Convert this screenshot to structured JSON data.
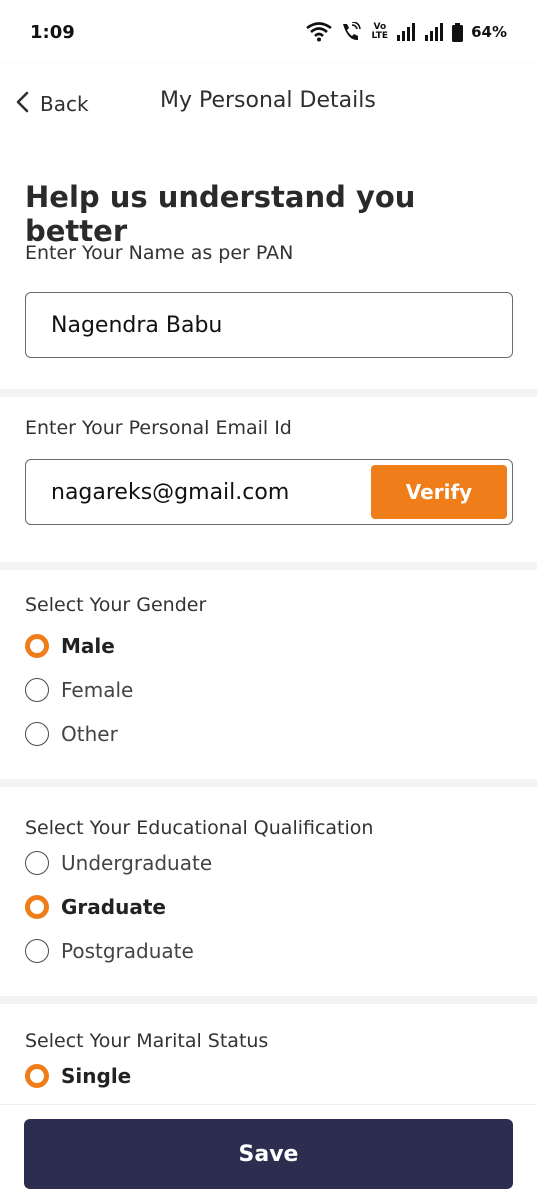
{
  "status_bar": {
    "time": "1:09",
    "battery": "64%",
    "volte_top": "Vo",
    "volte_bottom": "LTE"
  },
  "header": {
    "back_label": "Back",
    "title": "My Personal Details"
  },
  "form": {
    "heading": "Help us understand you better",
    "name": {
      "label": "Enter Your Name as per PAN",
      "value": "Nagendra Babu"
    },
    "email": {
      "label": "Enter Your Personal Email Id",
      "value": "nagareks@gmail.com",
      "verify_label": "Verify"
    },
    "gender": {
      "label": "Select Your Gender",
      "options": [
        "Male",
        "Female",
        "Other"
      ],
      "selected": "Male"
    },
    "education": {
      "label": "Select Your Educational Qualification",
      "options": [
        "Undergraduate",
        "Graduate",
        "Postgraduate"
      ],
      "selected": "Graduate"
    },
    "marital": {
      "label": "Select Your Marital Status",
      "options": [
        "Single"
      ],
      "selected": "Single"
    }
  },
  "footer": {
    "save_label": "Save"
  },
  "colors": {
    "accent": "#ef7d1a",
    "primary_button": "#2d2e4f"
  }
}
